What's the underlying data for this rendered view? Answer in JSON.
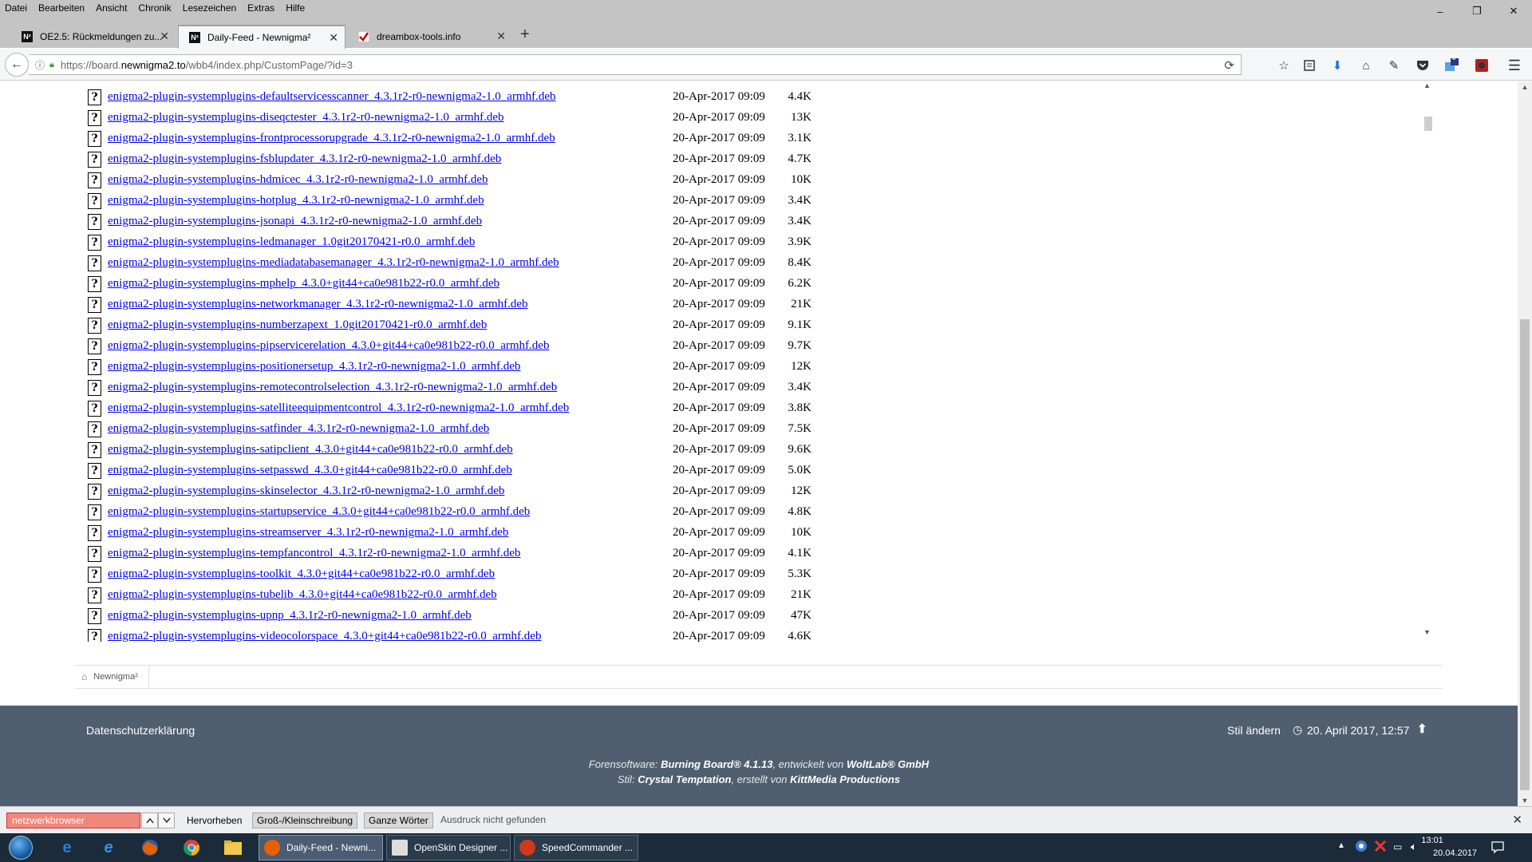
{
  "menu": [
    "Datei",
    "Bearbeiten",
    "Ansicht",
    "Chronik",
    "Lesezeichen",
    "Extras",
    "Hilfe"
  ],
  "window_controls": {
    "minimize": "–",
    "restore": "❐",
    "close": "✕"
  },
  "tabs": [
    {
      "label": "OE2.5: Rückmeldungen zu...",
      "favicon": "N²",
      "close": "✕",
      "active": false
    },
    {
      "label": "Daily-Feed - Newnigma²",
      "favicon": "N²",
      "close": "✕",
      "active": true
    },
    {
      "label": "dreambox-tools.info",
      "favicon": "check-icon",
      "close": "✕",
      "active": false
    }
  ],
  "new_tab": "+",
  "nav": {
    "url_prefix": "https://board.",
    "url_host": "newnigma2.to",
    "url_path": "/wbb4/index.php/CustomPage/?id=3",
    "back": "←",
    "reload": "⟳",
    "badge_count": "0"
  },
  "files": [
    {
      "name": "enigma2-plugin-systemplugins-defaultservicesscanner_4.3.1r2-r0-newnigma2-1.0_armhf.deb",
      "date": "20-Apr-2017 09:09",
      "size": "4.4K"
    },
    {
      "name": "enigma2-plugin-systemplugins-diseqctester_4.3.1r2-r0-newnigma2-1.0_armhf.deb",
      "date": "20-Apr-2017 09:09",
      "size": "13K"
    },
    {
      "name": "enigma2-plugin-systemplugins-frontprocessorupgrade_4.3.1r2-r0-newnigma2-1.0_armhf.deb",
      "date": "20-Apr-2017 09:09",
      "size": "3.1K"
    },
    {
      "name": "enigma2-plugin-systemplugins-fsblupdater_4.3.1r2-r0-newnigma2-1.0_armhf.deb",
      "date": "20-Apr-2017 09:09",
      "size": "4.7K"
    },
    {
      "name": "enigma2-plugin-systemplugins-hdmicec_4.3.1r2-r0-newnigma2-1.0_armhf.deb",
      "date": "20-Apr-2017 09:09",
      "size": "10K"
    },
    {
      "name": "enigma2-plugin-systemplugins-hotplug_4.3.1r2-r0-newnigma2-1.0_armhf.deb",
      "date": "20-Apr-2017 09:09",
      "size": "3.4K"
    },
    {
      "name": "enigma2-plugin-systemplugins-jsonapi_4.3.1r2-r0-newnigma2-1.0_armhf.deb",
      "date": "20-Apr-2017 09:09",
      "size": "3.4K"
    },
    {
      "name": "enigma2-plugin-systemplugins-ledmanager_1.0git20170421-r0.0_armhf.deb",
      "date": "20-Apr-2017 09:09",
      "size": "3.9K"
    },
    {
      "name": "enigma2-plugin-systemplugins-mediadatabasemanager_4.3.1r2-r0-newnigma2-1.0_armhf.deb",
      "date": "20-Apr-2017 09:09",
      "size": "8.4K"
    },
    {
      "name": "enigma2-plugin-systemplugins-mphelp_4.3.0+git44+ca0e981b22-r0.0_armhf.deb",
      "date": "20-Apr-2017 09:09",
      "size": "6.2K"
    },
    {
      "name": "enigma2-plugin-systemplugins-networkmanager_4.3.1r2-r0-newnigma2-1.0_armhf.deb",
      "date": "20-Apr-2017 09:09",
      "size": "21K"
    },
    {
      "name": "enigma2-plugin-systemplugins-numberzapext_1.0git20170421-r0.0_armhf.deb",
      "date": "20-Apr-2017 09:09",
      "size": "9.1K"
    },
    {
      "name": "enigma2-plugin-systemplugins-pipservicerelation_4.3.0+git44+ca0e981b22-r0.0_armhf.deb",
      "date": "20-Apr-2017 09:09",
      "size": "9.7K"
    },
    {
      "name": "enigma2-plugin-systemplugins-positionersetup_4.3.1r2-r0-newnigma2-1.0_armhf.deb",
      "date": "20-Apr-2017 09:09",
      "size": "12K"
    },
    {
      "name": "enigma2-plugin-systemplugins-remotecontrolselection_4.3.1r2-r0-newnigma2-1.0_armhf.deb",
      "date": "20-Apr-2017 09:09",
      "size": "3.4K"
    },
    {
      "name": "enigma2-plugin-systemplugins-satelliteequipmentcontrol_4.3.1r2-r0-newnigma2-1.0_armhf.deb",
      "date": "20-Apr-2017 09:09",
      "size": "3.8K"
    },
    {
      "name": "enigma2-plugin-systemplugins-satfinder_4.3.1r2-r0-newnigma2-1.0_armhf.deb",
      "date": "20-Apr-2017 09:09",
      "size": "7.5K"
    },
    {
      "name": "enigma2-plugin-systemplugins-satipclient_4.3.0+git44+ca0e981b22-r0.0_armhf.deb",
      "date": "20-Apr-2017 09:09",
      "size": "9.6K"
    },
    {
      "name": "enigma2-plugin-systemplugins-setpasswd_4.3.0+git44+ca0e981b22-r0.0_armhf.deb",
      "date": "20-Apr-2017 09:09",
      "size": "5.0K"
    },
    {
      "name": "enigma2-plugin-systemplugins-skinselector_4.3.1r2-r0-newnigma2-1.0_armhf.deb",
      "date": "20-Apr-2017 09:09",
      "size": "12K"
    },
    {
      "name": "enigma2-plugin-systemplugins-startupservice_4.3.0+git44+ca0e981b22-r0.0_armhf.deb",
      "date": "20-Apr-2017 09:09",
      "size": "4.8K"
    },
    {
      "name": "enigma2-plugin-systemplugins-streamserver_4.3.1r2-r0-newnigma2-1.0_armhf.deb",
      "date": "20-Apr-2017 09:09",
      "size": "10K"
    },
    {
      "name": "enigma2-plugin-systemplugins-tempfancontrol_4.3.1r2-r0-newnigma2-1.0_armhf.deb",
      "date": "20-Apr-2017 09:09",
      "size": "4.1K"
    },
    {
      "name": "enigma2-plugin-systemplugins-toolkit_4.3.0+git44+ca0e981b22-r0.0_armhf.deb",
      "date": "20-Apr-2017 09:09",
      "size": "5.3K"
    },
    {
      "name": "enigma2-plugin-systemplugins-tubelib_4.3.0+git44+ca0e981b22-r0.0_armhf.deb",
      "date": "20-Apr-2017 09:09",
      "size": "21K"
    },
    {
      "name": "enigma2-plugin-systemplugins-upnp_4.3.1r2-r0-newnigma2-1.0_armhf.deb",
      "date": "20-Apr-2017 09:09",
      "size": "47K"
    },
    {
      "name": "enigma2-plugin-systemplugins-videocolorspace_4.3.0+git44+ca0e981b22-r0.0_armhf.deb",
      "date": "20-Apr-2017 09:09",
      "size": "4.6K"
    }
  ],
  "breadcrumb": {
    "label": "Newnigma²"
  },
  "footer": {
    "privacy": "Datenschutzerklärung",
    "style": "Stil ändern",
    "date": "20. April 2017, 12:57",
    "credit1_pre": "Forensoftware: ",
    "credit1_product": "Burning Board® 4.1.13",
    "credit1_mid": ", entwickelt von ",
    "credit1_company": "WoltLab® GmbH",
    "credit2_pre": "Stil: ",
    "credit2_style": "Crystal Temptation",
    "credit2_mid": ", erstellt von ",
    "credit2_author": "KittMedia Productions"
  },
  "findbar": {
    "query": "netzwerkbrowser",
    "highlight": "Hervorheben",
    "match_case": "Groß-/Kleinschreibung",
    "whole_words": "Ganze Wörter",
    "status": "Ausdruck nicht gefunden"
  },
  "taskbar": {
    "tasks": [
      {
        "label": "Daily-Feed - Newni...",
        "color": "#e66000"
      },
      {
        "label": "OpenSkin Designer ...",
        "color": "#ddd"
      },
      {
        "label": "SpeedCommander ...",
        "color": "#d03a1a"
      }
    ],
    "time": "13:01",
    "date": "20.04.2017"
  },
  "colors": {
    "link": "#0000ee",
    "footer_bg": "#4f5f70",
    "find_not_found": "#f0877c"
  }
}
